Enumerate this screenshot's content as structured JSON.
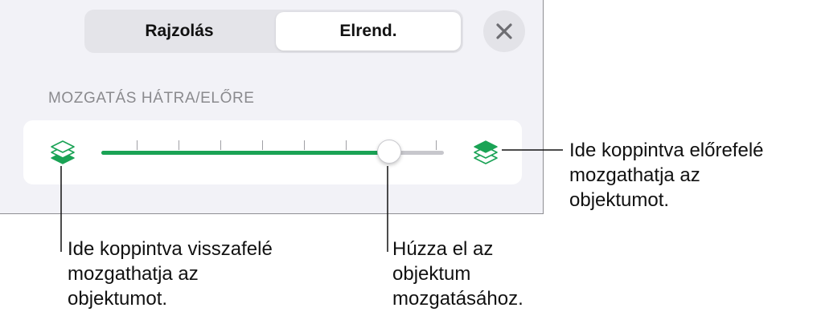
{
  "tabs": [
    {
      "label": "Rajzolás",
      "selected": false
    },
    {
      "label": "Elrend.",
      "selected": true
    }
  ],
  "close": {
    "icon": "close-icon"
  },
  "section": {
    "label": "MOZGATÁS HÁTRA/ELŐRE"
  },
  "slider": {
    "value_fraction": 0.84,
    "tick_count": 6,
    "accent_color": "#1aa355",
    "track_color": "#c7c7cc"
  },
  "icons": {
    "back": "send-backward-icon",
    "front": "bring-forward-icon"
  },
  "callouts": {
    "front": "Ide koppintva előrefelé\nmozgathatja az\nobjektumot.",
    "back": "Ide koppintva visszafelé\nmozgathatja az\nobjektumot.",
    "drag": "Húzza el az\nobjektum\nmozgatásához."
  }
}
